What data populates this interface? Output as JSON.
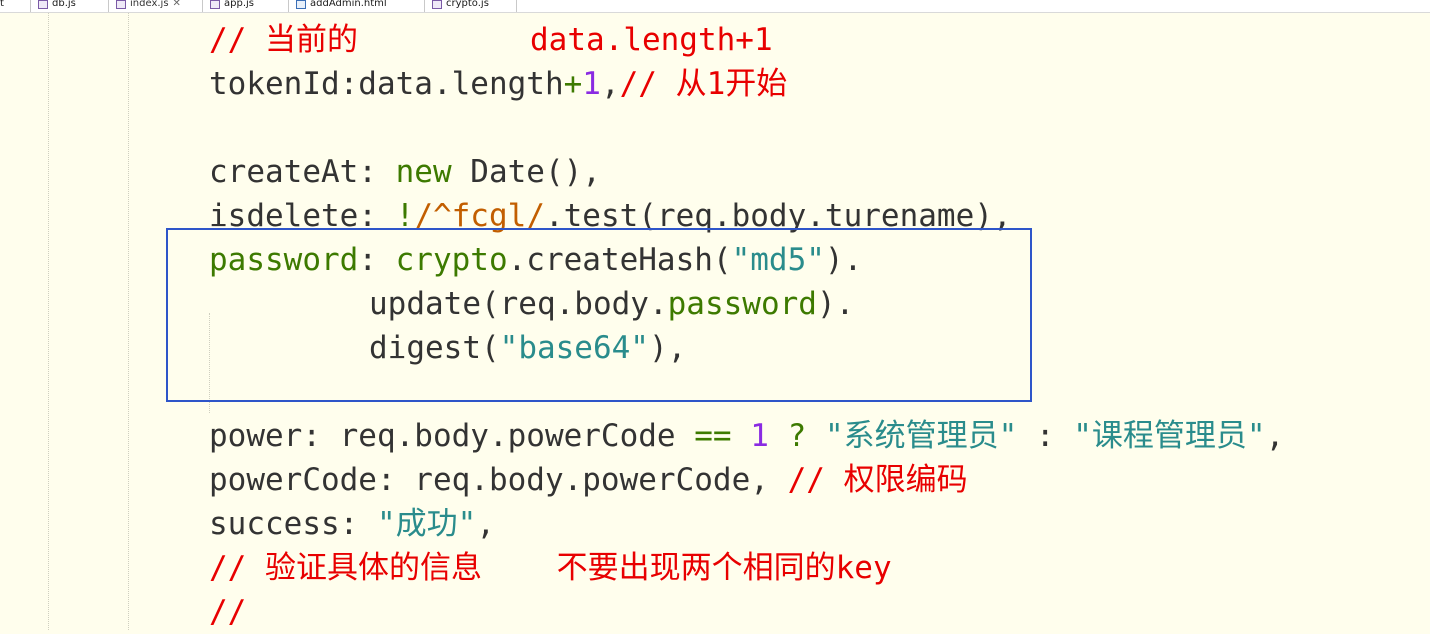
{
  "tabs": [
    {
      "label": "t",
      "active": false
    },
    {
      "label": "db.js",
      "active": false
    },
    {
      "label": "index.js",
      "active": true
    },
    {
      "label": "app.js",
      "active": false
    },
    {
      "label": "addAdmin.html",
      "active": false
    },
    {
      "label": "crypto.js",
      "active": false
    }
  ],
  "code": {
    "l1_comment": "// 当前的",
    "l1_comment2": "data.length+1",
    "l2_a": "tokenId:data.length",
    "l2_plus": "+",
    "l2_num": "1",
    "l2_comma": ",",
    "l2_comment": "// 从1开始",
    "l4_a": "createAt: ",
    "l4_new": "new",
    "l4_b": " Date(),",
    "l5_a": "isdelete: ",
    "l5_bang": "!",
    "l5_regex": "/^fcgl/",
    "l5_b": ".test(req.body.turename),",
    "l6_key": "password",
    "l6_a": ": ",
    "l6_crypto": "crypto",
    "l6_b": ".createHash(",
    "l6_str": "\"md5\"",
    "l6_c": ").",
    "l7_a": "update(req.body.",
    "l7_prop": "password",
    "l7_b": ").",
    "l8_a": "digest(",
    "l8_str": "\"base64\"",
    "l8_b": "),",
    "l10_a": "power: req.body.powerCode ",
    "l10_op": "==",
    "l10_sp": " ",
    "l10_num": "1",
    "l10_q": " ? ",
    "l10_str1": "\"系统管理员\"",
    "l10_colon": " : ",
    "l10_str2": "\"课程管理员\"",
    "l10_end": ",",
    "l11_a": "powerCode: req.body.powerCode, ",
    "l11_comment": "// 权限编码",
    "l12_a": "success: ",
    "l12_str": "\"成功\"",
    "l12_b": ",",
    "l13_comment": "// 验证具体的信息    不要出现两个相同的key",
    "l14_comment": "//"
  },
  "colors": {
    "background": "#fffeed",
    "comment": "#e80000",
    "keyword": "#3d7a00",
    "string": "#2a8c8c",
    "number": "#8a2be2",
    "highlight_box": "#2e55c9"
  }
}
